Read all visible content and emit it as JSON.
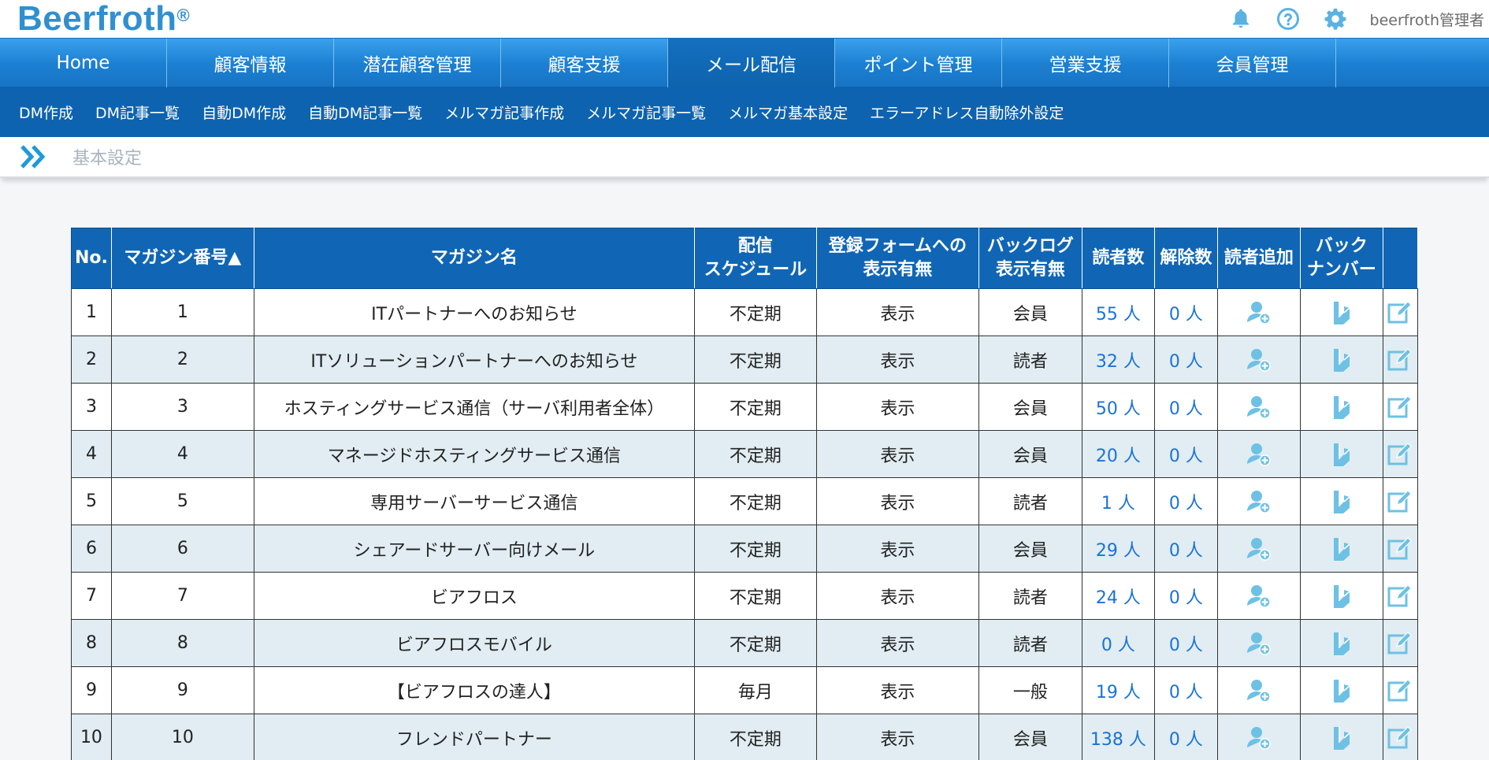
{
  "header": {
    "logo": "Beerfroth",
    "logo_mark": "®",
    "user": "beerfroth管理者"
  },
  "main_nav": [
    {
      "label": "Home",
      "active": false
    },
    {
      "label": "顧客情報",
      "active": false
    },
    {
      "label": "潜在顧客管理",
      "active": false
    },
    {
      "label": "顧客支援",
      "active": false
    },
    {
      "label": "メール配信",
      "active": true
    },
    {
      "label": "ポイント管理",
      "active": false
    },
    {
      "label": "営業支援",
      "active": false
    },
    {
      "label": "会員管理",
      "active": false
    }
  ],
  "sub_nav": [
    "DM作成",
    "DM記事一覧",
    "自動DM作成",
    "自動DM記事一覧",
    "メルマガ記事作成",
    "メルマガ記事一覧",
    "メルマガ基本設定",
    "エラーアドレス自動除外設定"
  ],
  "breadcrumb": {
    "current": "基本設定"
  },
  "table": {
    "headers": {
      "no": "No.",
      "mag_no": "マガジン番号▲",
      "name": "マガジン名",
      "schedule_1": "配信",
      "schedule_2": "スケジュール",
      "form_1": "登録フォームへの",
      "form_2": "表示有無",
      "backlog_1": "バックログ",
      "backlog_2": "表示有無",
      "readers": "読者数",
      "cancels": "解除数",
      "add_reader": "読者追加",
      "backnumber_1": "バック",
      "backnumber_2": "ナンバー"
    },
    "rows": [
      {
        "no": "1",
        "mag_no": "1",
        "name": "ITパートナーへのお知らせ",
        "schedule": "不定期",
        "form": "表示",
        "backlog": "会員",
        "readers": "55 人",
        "cancels": "0 人"
      },
      {
        "no": "2",
        "mag_no": "2",
        "name": "ITソリューションパートナーへのお知らせ",
        "schedule": "不定期",
        "form": "表示",
        "backlog": "読者",
        "readers": "32 人",
        "cancels": "0 人"
      },
      {
        "no": "3",
        "mag_no": "3",
        "name": "ホスティングサービス通信（サーバ利用者全体）",
        "schedule": "不定期",
        "form": "表示",
        "backlog": "会員",
        "readers": "50 人",
        "cancels": "0 人"
      },
      {
        "no": "4",
        "mag_no": "4",
        "name": "マネージドホスティングサービス通信",
        "schedule": "不定期",
        "form": "表示",
        "backlog": "会員",
        "readers": "20 人",
        "cancels": "0 人"
      },
      {
        "no": "5",
        "mag_no": "5",
        "name": "専用サーバーサービス通信",
        "schedule": "不定期",
        "form": "表示",
        "backlog": "読者",
        "readers": "1 人",
        "cancels": "0 人"
      },
      {
        "no": "6",
        "mag_no": "6",
        "name": "シェアードサーバー向けメール",
        "schedule": "不定期",
        "form": "表示",
        "backlog": "会員",
        "readers": "29 人",
        "cancels": "0 人"
      },
      {
        "no": "7",
        "mag_no": "7",
        "name": "ビアフロス",
        "schedule": "不定期",
        "form": "表示",
        "backlog": "読者",
        "readers": "24 人",
        "cancels": "0 人"
      },
      {
        "no": "8",
        "mag_no": "8",
        "name": "ビアフロスモバイル",
        "schedule": "不定期",
        "form": "表示",
        "backlog": "読者",
        "readers": "0 人",
        "cancels": "0 人"
      },
      {
        "no": "9",
        "mag_no": "9",
        "name": "【ビアフロスの達人】",
        "schedule": "毎月",
        "form": "表示",
        "backlog": "一般",
        "readers": "19 人",
        "cancels": "0 人"
      },
      {
        "no": "10",
        "mag_no": "10",
        "name": "フレンドパートナー",
        "schedule": "不定期",
        "form": "表示",
        "backlog": "会員",
        "readers": "138 人",
        "cancels": "0 人"
      }
    ]
  },
  "icons": {
    "bell": "bell-icon",
    "help": "help-icon",
    "gear": "gear-icon",
    "chevron": "double-chevron-right-icon",
    "add_reader": "user-plus-icon",
    "backnumber": "backnumber-icon",
    "edit": "edit-icon"
  },
  "colors": {
    "logo": "#2f8fd0",
    "nav": "#1b7fd1",
    "nav_active": "#0e63ad",
    "subnav": "#0d63b0",
    "table_header": "#1066b4",
    "icon": "#6ec1e4",
    "link": "#1a73d6"
  }
}
